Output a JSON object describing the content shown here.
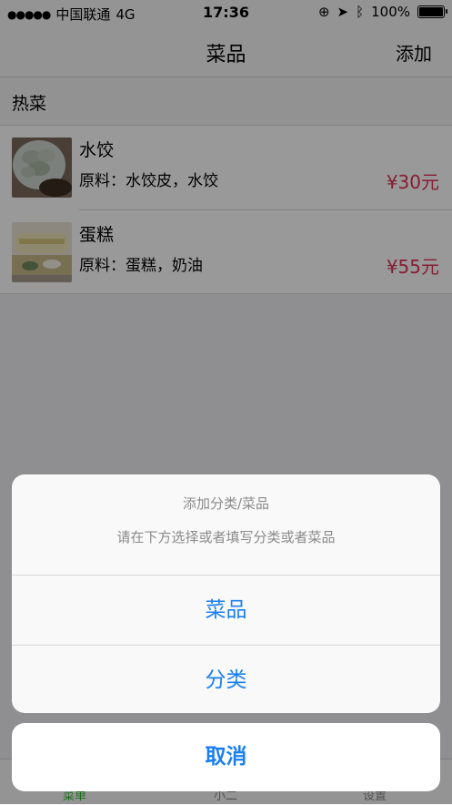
{
  "status": {
    "carrier": "中国联通",
    "network": "4G",
    "time": "17:36",
    "battery": "100%"
  },
  "nav": {
    "title": "菜品",
    "add_label": "添加"
  },
  "section": {
    "title": "热菜"
  },
  "dishes": [
    {
      "name": "水饺",
      "ingredients": "原料：水饺皮，水饺",
      "price": "¥30元"
    },
    {
      "name": "蛋糕",
      "ingredients": "原料：蛋糕，奶油",
      "price": "¥55元"
    }
  ],
  "tabs": [
    {
      "label": "菜单"
    },
    {
      "label": "小二"
    },
    {
      "label": "设置"
    }
  ],
  "action_sheet": {
    "title": "添加分类/菜品",
    "message": "请在下方选择或者填写分类或者菜品",
    "options": [
      {
        "label": "菜品"
      },
      {
        "label": "分类"
      }
    ],
    "cancel_label": "取消"
  },
  "colors": {
    "accent": "#1a7ff0",
    "price": "#e03256",
    "tab_active": "#2dbb2d"
  }
}
